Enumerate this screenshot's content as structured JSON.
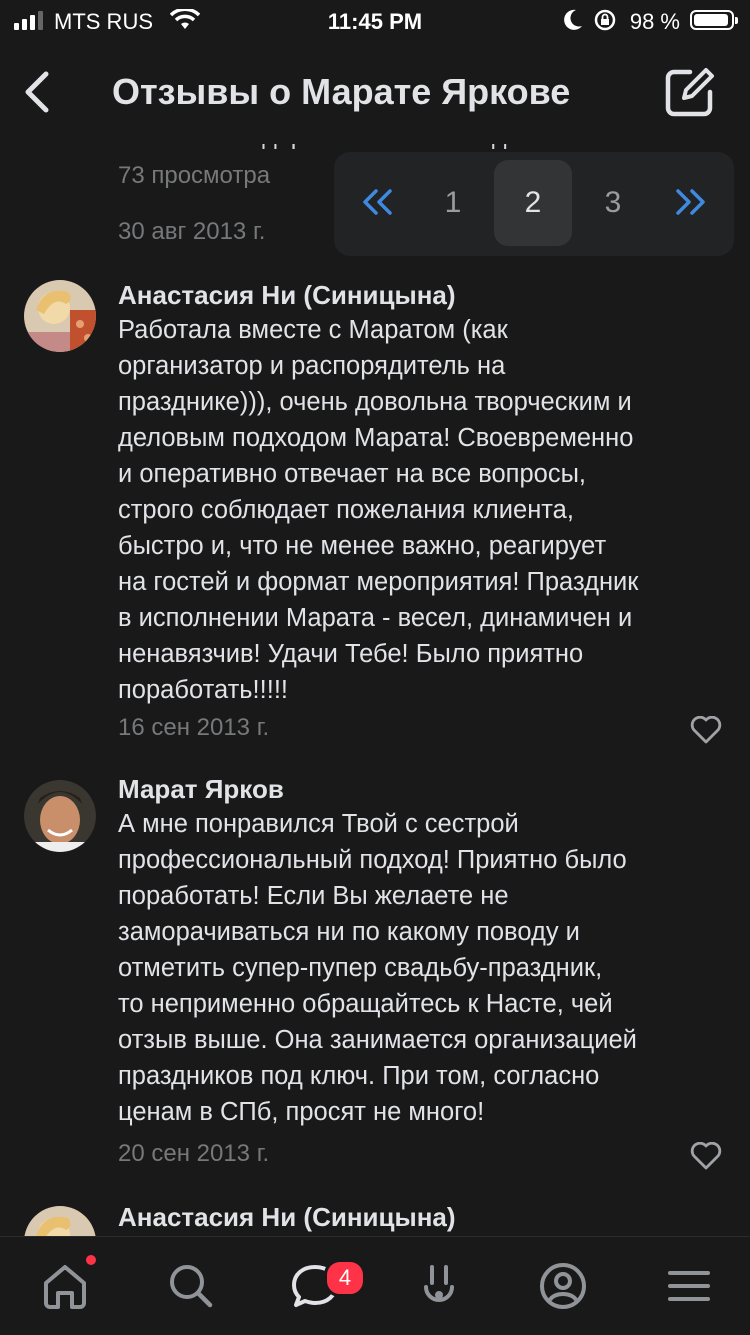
{
  "status_bar": {
    "carrier": "MTS RUS",
    "time": "11:45 PM",
    "battery": "98 %"
  },
  "header": {
    "title": "Отзывы о Марате Яркове"
  },
  "top_item": {
    "cut_text": "Слова благодарности после свадьбы",
    "views": "73 просмотра",
    "date": "30 авг 2013 г."
  },
  "pagination": {
    "pages": [
      "1",
      "2",
      "3"
    ],
    "current": "2"
  },
  "comments": [
    {
      "author": "Анастасия Ни (Синицына)",
      "lines": [
        "Работала вместе с Маратом (как",
        "организатор и  распорядитель на",
        "празднике))), очень довольна творческим и",
        "деловым подходом Марата! Своевременно",
        "и оперативно отвечает на все вопросы,",
        "строго соблюдает пожелания  клиента,",
        "быстро и, что  не менее важно, реагирует",
        "на гостей и формат мероприятия! Праздник",
        "в исполнении Марата - весел, динамичен и",
        "ненавязчив! Удачи Тебе! Было приятно",
        "поработать!!!!!"
      ],
      "date": "16 сен 2013 г."
    },
    {
      "author": "Марат Ярков",
      "lines": [
        "А мне понравился Твой с сестрой",
        "профессиональный подход! Приятно было",
        "поработать! Если Вы желаете не",
        "заморачиваться ни по какому поводу и",
        "отметить супер-пупер свадьбу-праздник,",
        "то неприменно обращайтесь к Насте, чей",
        "отзыв выше. Она занимается организацией",
        "праздников под ключ. При том, согласно",
        "ценам в СПб, просят не много!"
      ],
      "date": "20 сен 2013 г."
    },
    {
      "author": "Анастасия Ни (Синицына)"
    }
  ],
  "tabbar": {
    "items": [
      "home-icon",
      "search-icon",
      "messages-icon",
      "clips-icon",
      "profile-icon",
      "menu-icon"
    ],
    "messages_badge": "4"
  }
}
